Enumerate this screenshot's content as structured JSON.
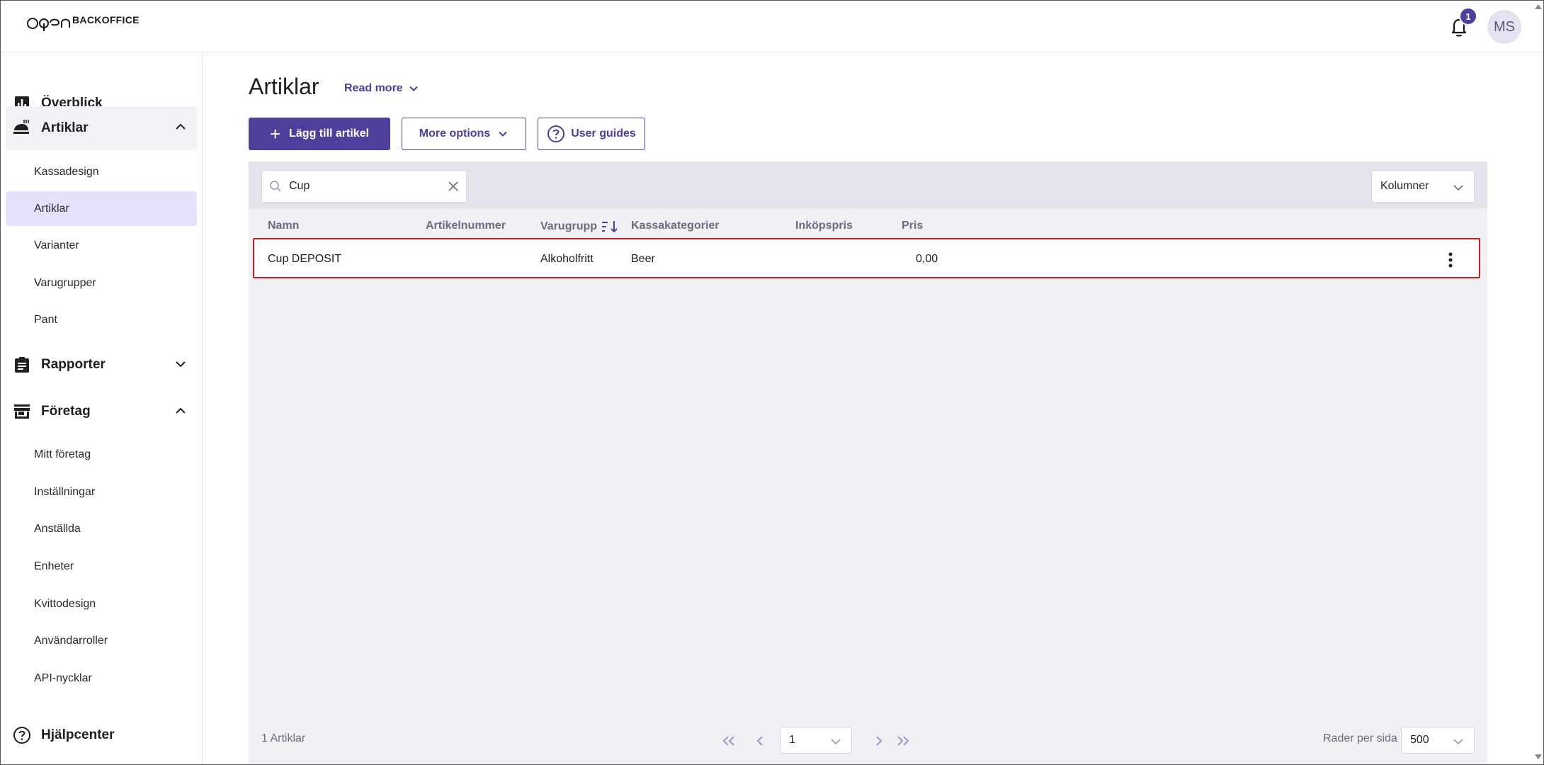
{
  "header": {
    "logo_text": "BACKOFFICE",
    "notification_count": "1",
    "avatar_initials": "MS"
  },
  "sidebar": {
    "overview": "Överblick",
    "articles_group": "Artiklar",
    "articles_items": [
      "Kassadesign",
      "Artiklar",
      "Varianter",
      "Varugrupper",
      "Pant"
    ],
    "reports_group": "Rapporter",
    "company_group": "Företag",
    "company_items": [
      "Mitt företag",
      "Inställningar",
      "Anställda",
      "Enheter",
      "Kvittodesign",
      "Användarroller",
      "API-nycklar"
    ],
    "help": "Hjälpcenter",
    "active_item": "Artiklar"
  },
  "main": {
    "title": "Artiklar",
    "read_more": "Read more",
    "add_button": "Lägg till artikel",
    "more_options": "More options",
    "user_guides": "User guides"
  },
  "table": {
    "search_value": "Cup",
    "columns_button": "Kolumner",
    "headers": [
      "Namn",
      "Artikelnummer",
      "Varugrupp",
      "Kassakategorier",
      "Inköpspris",
      "Pris"
    ],
    "sorted_column": "Varugrupp",
    "rows": [
      {
        "name": "Cup DEPOSIT",
        "article_number": "",
        "product_group": "Alkoholfritt",
        "pos_category": "Beer",
        "purchase_price": "",
        "price": "0,00"
      }
    ],
    "count_text": "1 Artiklar",
    "current_page": "1",
    "rows_per_page_label": "Rader per sida",
    "rows_per_page": "500"
  },
  "colors": {
    "accent": "#4d3f9a",
    "active_bg": "#e6e2fb",
    "highlight_border": "#cc1b24"
  }
}
